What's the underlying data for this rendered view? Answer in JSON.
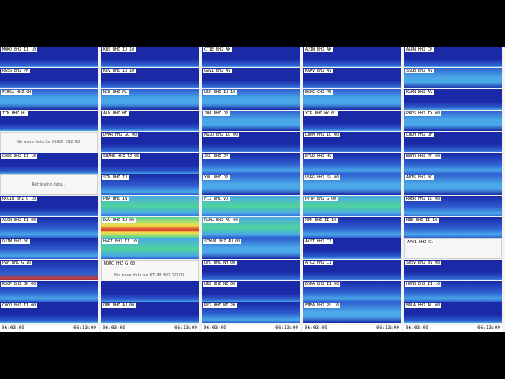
{
  "columns": [
    {
      "tiles": [
        {
          "label": "MOKO BHZ II 10",
          "style": "dark"
        },
        {
          "label": "RGSS BHZ PM",
          "style": "dark"
        },
        {
          "label": "FIESA HHZ CH",
          "style": "bright"
        },
        {
          "label": "ITM HHZ HL",
          "style": "dark"
        },
        {
          "label": "",
          "style": "blank",
          "message": "No wave data for GUKO HHZ KO."
        },
        {
          "label": "GOSS BHZ II 10",
          "style": "dark"
        },
        {
          "label": "",
          "style": "blank",
          "message": "Retrieving data..."
        },
        {
          "label": "RCGIM BHZ G 10",
          "style": "dark"
        },
        {
          "label": "ASCN BHZ II 00",
          "style": "mid"
        },
        {
          "label": "DJIM BHZ 00",
          "style": "mid"
        },
        {
          "label": "PAF BHZ G 10",
          "style": "partial"
        },
        {
          "label": "RSCP BHZ BN 00",
          "style": "mid"
        },
        {
          "label": "COCO BHZ II 00",
          "style": "dark"
        }
      ],
      "time_start": "06:03:09",
      "time_end": "06:13:09"
    },
    {
      "tiles": [
        {
          "label": "KBS BHZ IU 10",
          "style": "dark"
        },
        {
          "label": "KEV BHZ IU 10",
          "style": "dark"
        },
        {
          "label": "NIE BHZ PL",
          "style": "bright"
        },
        {
          "label": "ALN HHZ HT",
          "style": "dark"
        },
        {
          "label": "DVKR HHZ GO 00",
          "style": "dark"
        },
        {
          "label": "SHAHR HHZ TJ 00",
          "style": "dark"
        },
        {
          "label": "SYN BHZ IU",
          "style": "mid"
        },
        {
          "label": "PBA HHZ IN",
          "style": "green"
        },
        {
          "label": "DAV BHZ IU 00",
          "style": "yellow"
        },
        {
          "label": "HAPI BHZ II 10",
          "style": "green"
        },
        {
          "label": "NOUC HHZ G 00",
          "style": "blank-title",
          "message": "No wave data for BTUM BHZ ZO 00."
        },
        {
          "label": "",
          "style": "dark"
        },
        {
          "label": "ONB BHZ AU 00",
          "style": "dark"
        }
      ],
      "time_start": "06:03:09",
      "time_end": "06:13:09"
    },
    {
      "tiles": [
        {
          "label": "CTIE BHZ AK",
          "style": "dark"
        },
        {
          "label": "GAVI BHZ AV",
          "style": "dark"
        },
        {
          "label": "ULN BHZ IU 10",
          "style": "bright"
        },
        {
          "label": "JHA BHZ JP",
          "style": "bright"
        },
        {
          "label": "MAJO BHZ IU 00",
          "style": "dark"
        },
        {
          "label": "JSU BHZ JP",
          "style": "mid"
        },
        {
          "label": "YOU BHZ JP",
          "style": "bright"
        },
        {
          "label": "FIJ BHZ VU",
          "style": "green"
        },
        {
          "label": "RAML BHZ AU 00",
          "style": "green"
        },
        {
          "label": "SYMVU BHZ AU 00",
          "style": "bright"
        },
        {
          "label": "UFO HHZ NH 00",
          "style": "dark"
        },
        {
          "label": "URZ HHZ NZ 00",
          "style": "dark"
        },
        {
          "label": "RF2 HHZ NZ 20",
          "style": "mid"
        }
      ],
      "time_start": "06:03:09",
      "time_end": "06:13:09"
    },
    {
      "tiles": [
        {
          "label": "A2IN BHZ AK",
          "style": "dark"
        },
        {
          "label": "KGKV BHZ AV",
          "style": "dark"
        },
        {
          "label": "BGKC CHZ PB",
          "style": "bright"
        },
        {
          "label": "YTP BHZ WY 01",
          "style": "dark"
        },
        {
          "label": "LHNM HHZ IU 00",
          "style": "dark"
        },
        {
          "label": "DTLD HHZ HV",
          "style": "mid"
        },
        {
          "label": "VSRG HHZ SV 00",
          "style": "bright"
        },
        {
          "label": "PFTP BHZ G 00",
          "style": "green"
        },
        {
          "label": "RPN BHZ II 10",
          "style": "mid"
        },
        {
          "label": "ACST HHZ C1",
          "style": "dark"
        },
        {
          "label": "AYG2 HHZ C1",
          "style": "dark"
        },
        {
          "label": "DSPA BHZ II 00",
          "style": "mid"
        },
        {
          "label": "FMBA BHZ PL 10",
          "style": "bright"
        }
      ],
      "time_start": "06:03:09",
      "time_end": "06:13:09"
    },
    {
      "tiles": [
        {
          "label": "ALRN HHZ CN",
          "style": "dark"
        },
        {
          "label": "SSLB BHZ AV",
          "style": "bright"
        },
        {
          "label": "KAKN BHZ AV",
          "style": "dark"
        },
        {
          "label": "PBDS HHZ TX 00",
          "style": "bright"
        },
        {
          "label": "CHDH HHZ OH",
          "style": "dark"
        },
        {
          "label": "BBPR HHZ PR 00",
          "style": "mid"
        },
        {
          "label": "ANTS BHZ BC",
          "style": "bright"
        },
        {
          "label": "ROBR HHZ IU 00",
          "style": "mid"
        },
        {
          "label": "NNB BHZ II 10",
          "style": "mid"
        },
        {
          "label": "AF01 HHZ C1",
          "style": "blank-title",
          "message": ""
        },
        {
          "label": "SOSV BHZ BV 00",
          "style": "dark"
        },
        {
          "label": "HOFB BHZ II 10",
          "style": "mid"
        },
        {
          "label": "BRLA HHZ AU 00",
          "style": "dark"
        }
      ],
      "time_start": "06:03:09",
      "time_end": "06:13:09"
    }
  ],
  "colors": {
    "dark": "#1a2aa6",
    "mid": "#2f5fd0",
    "bright": "#4aa8e8",
    "green": "#4fd49a",
    "yellow": "#f2e14a",
    "red": "#d83a2a"
  }
}
